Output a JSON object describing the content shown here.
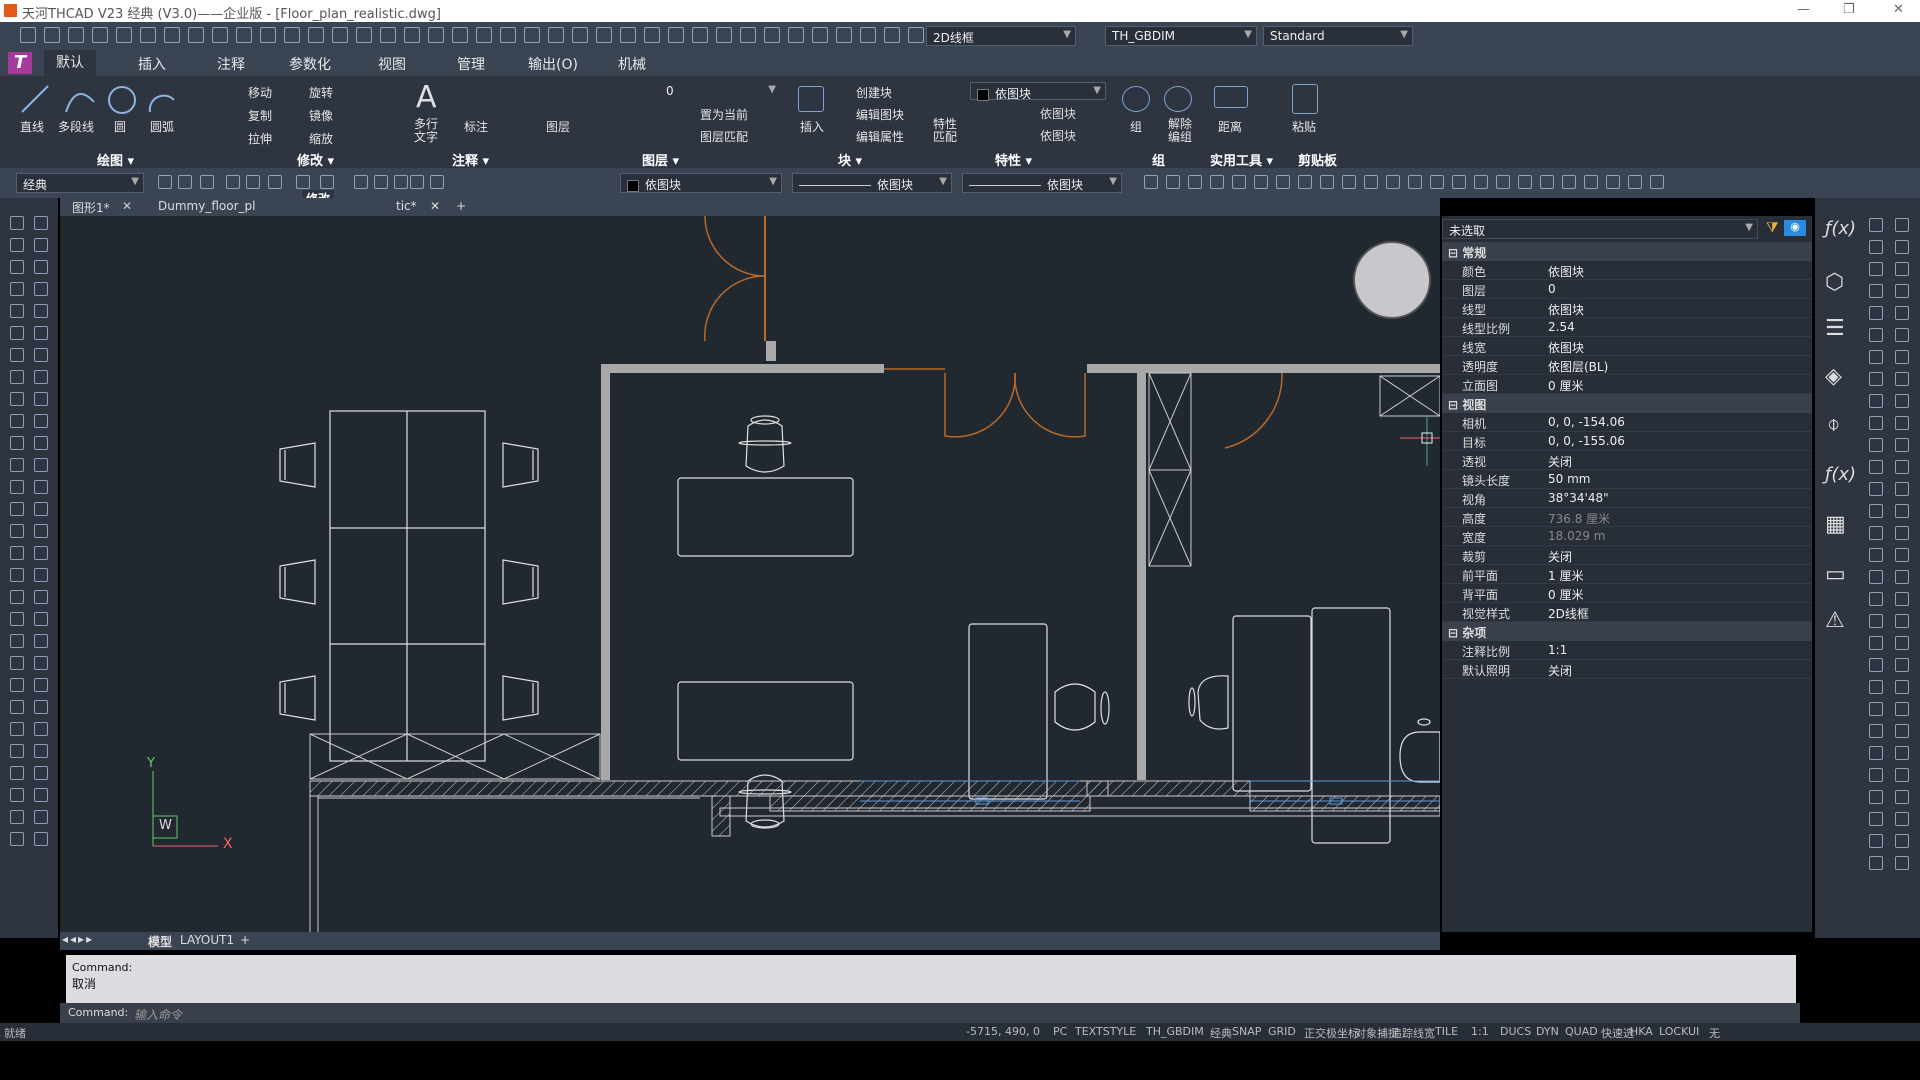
{
  "titlebar": {
    "title": "天河THCAD V23 经典 (V3.0)——企业版 - [Floor_plan_realistic.dwg]",
    "minimize": "—",
    "restore": "❐",
    "close": "✕"
  },
  "qat": {
    "visual_style": "2D线框",
    "layer": "TH_GBDIM",
    "text_style": "Standard"
  },
  "ribbon_tabs": [
    "默认",
    "插入",
    "注释",
    "参数化",
    "视图",
    "管理",
    "输出(O)",
    "机械"
  ],
  "ribbon": {
    "draw": {
      "labels": [
        "直线",
        "多段线",
        "圆",
        "圆弧"
      ],
      "group": "绘图 ▾"
    },
    "modify": {
      "labels": [
        "移动",
        "旋转",
        "复制",
        "镜像",
        "拉伸",
        "缩放"
      ],
      "group": "修改 ▾"
    },
    "annot": {
      "labels": [
        "多行文字",
        "标注"
      ],
      "group": "注释 ▾"
    },
    "layer": {
      "label": "图层",
      "current": "0",
      "set_current": "置为当前",
      "match": "图层匹配",
      "group": "图层 ▾"
    },
    "block": {
      "insert": "插入",
      "create": "创建块",
      "edit": "编辑图块",
      "edit_attr": "编辑属性",
      "group": "块 ▾"
    },
    "props": {
      "match": "特性匹配",
      "color": "依图块",
      "linetype": "依图块",
      "lineweight": "依图块",
      "group": "特性 ▾"
    },
    "groups": {
      "group": "组",
      "ungroup": "解除编组",
      "label": "组"
    },
    "util": {
      "measure": "距离",
      "label": "实用工具 ▾"
    },
    "clip": {
      "paste": "粘贴",
      "label": "剪贴板"
    }
  },
  "toolbar3": {
    "workspace": "经典",
    "color": "依图块",
    "linetype": "依图块",
    "lineweight": "依图块"
  },
  "tooltip": "修改",
  "doc_tabs": [
    "图形1*",
    "Dummy_floor_pl",
    "tic*"
  ],
  "layout_tabs": {
    "model": "模型",
    "layout1": "LAYOUT1",
    "add": "+"
  },
  "ucs": {
    "y": "Y",
    "x": "X",
    "w": "W"
  },
  "properties": {
    "selection": "未选取",
    "sections": [
      {
        "title": "常规",
        "rows": [
          [
            "颜色",
            "依图块"
          ],
          [
            "图层",
            "0"
          ],
          [
            "线型",
            "依图块"
          ],
          [
            "线型比例",
            "2.54"
          ],
          [
            "线宽",
            "依图块"
          ],
          [
            "透明度",
            "依图层(BL)"
          ],
          [
            "立面图",
            "0 厘米"
          ]
        ]
      },
      {
        "title": "视图",
        "rows": [
          [
            "相机",
            "0, 0, -154.06"
          ],
          [
            "目标",
            "0, 0, -155.06"
          ],
          [
            "透视",
            "关闭"
          ],
          [
            "镜头长度",
            "50 mm"
          ],
          [
            "视角",
            "38°34'48\""
          ],
          [
            "高度",
            "736.8 厘米"
          ],
          [
            "宽度",
            "18.029 m"
          ],
          [
            "裁剪",
            "关闭"
          ],
          [
            "前平面",
            "1 厘米"
          ],
          [
            "背平面",
            "0 厘米"
          ],
          [
            "视觉样式",
            "2D线框"
          ]
        ]
      },
      {
        "title": "杂项",
        "rows": [
          [
            "注释比例",
            "1:1"
          ],
          [
            "默认照明",
            "关闭"
          ]
        ]
      }
    ]
  },
  "command": {
    "history1": "Command:",
    "history2": "取消",
    "prompt": "Command:",
    "placeholder": "输入命令"
  },
  "status": {
    "ready": "就绪",
    "coords": "-5715, 490, 0",
    "items": [
      "PC",
      "TEXTSTYLE",
      "TH_GBDIM",
      "经典",
      "SNAP",
      "GRID",
      "正交",
      "极坐标",
      "对象捕捉",
      "追踪",
      "线宽",
      "TILE",
      "1:1",
      "DUCS",
      "DYN",
      "QUAD",
      "快速选",
      "HKA",
      "LOCKUI",
      "无"
    ]
  },
  "colors": {
    "canvas": "#212830",
    "wall": "#a8a8a8",
    "door": "#b86a2a",
    "line": "#e0e0e0",
    "accent": "#2a8ae0"
  }
}
